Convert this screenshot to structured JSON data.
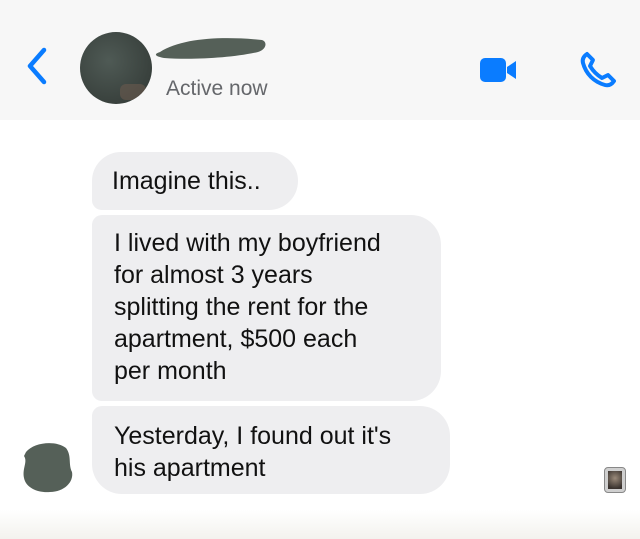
{
  "header": {
    "status": "Active now",
    "icons": {
      "back": "chevron-left-icon",
      "video": "video-camera-icon",
      "call": "phone-icon"
    }
  },
  "colors": {
    "accent": "#0a7cff",
    "bubble": "#eeeef0",
    "status_text": "#65676b",
    "redaction": "#556058"
  },
  "messages": [
    {
      "text": "Imagine this.."
    },
    {
      "text": "I lived with my boyfriend\nfor almost 3 years\nsplitting the rent for the\napartment, $500 each\nper month"
    },
    {
      "text": "Yesterday, I found out it's\nhis apartment"
    }
  ]
}
